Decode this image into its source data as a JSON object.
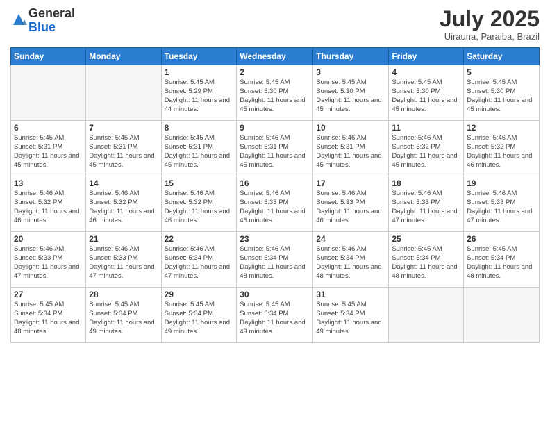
{
  "logo": {
    "general": "General",
    "blue": "Blue"
  },
  "title": "July 2025",
  "location": "Uirauna, Paraiba, Brazil",
  "headers": [
    "Sunday",
    "Monday",
    "Tuesday",
    "Wednesday",
    "Thursday",
    "Friday",
    "Saturday"
  ],
  "weeks": [
    [
      {
        "day": "",
        "info": ""
      },
      {
        "day": "",
        "info": ""
      },
      {
        "day": "1",
        "info": "Sunrise: 5:45 AM\nSunset: 5:29 PM\nDaylight: 11 hours and 44 minutes."
      },
      {
        "day": "2",
        "info": "Sunrise: 5:45 AM\nSunset: 5:30 PM\nDaylight: 11 hours and 45 minutes."
      },
      {
        "day": "3",
        "info": "Sunrise: 5:45 AM\nSunset: 5:30 PM\nDaylight: 11 hours and 45 minutes."
      },
      {
        "day": "4",
        "info": "Sunrise: 5:45 AM\nSunset: 5:30 PM\nDaylight: 11 hours and 45 minutes."
      },
      {
        "day": "5",
        "info": "Sunrise: 5:45 AM\nSunset: 5:30 PM\nDaylight: 11 hours and 45 minutes."
      }
    ],
    [
      {
        "day": "6",
        "info": "Sunrise: 5:45 AM\nSunset: 5:31 PM\nDaylight: 11 hours and 45 minutes."
      },
      {
        "day": "7",
        "info": "Sunrise: 5:45 AM\nSunset: 5:31 PM\nDaylight: 11 hours and 45 minutes."
      },
      {
        "day": "8",
        "info": "Sunrise: 5:45 AM\nSunset: 5:31 PM\nDaylight: 11 hours and 45 minutes."
      },
      {
        "day": "9",
        "info": "Sunrise: 5:46 AM\nSunset: 5:31 PM\nDaylight: 11 hours and 45 minutes."
      },
      {
        "day": "10",
        "info": "Sunrise: 5:46 AM\nSunset: 5:31 PM\nDaylight: 11 hours and 45 minutes."
      },
      {
        "day": "11",
        "info": "Sunrise: 5:46 AM\nSunset: 5:32 PM\nDaylight: 11 hours and 45 minutes."
      },
      {
        "day": "12",
        "info": "Sunrise: 5:46 AM\nSunset: 5:32 PM\nDaylight: 11 hours and 46 minutes."
      }
    ],
    [
      {
        "day": "13",
        "info": "Sunrise: 5:46 AM\nSunset: 5:32 PM\nDaylight: 11 hours and 46 minutes."
      },
      {
        "day": "14",
        "info": "Sunrise: 5:46 AM\nSunset: 5:32 PM\nDaylight: 11 hours and 46 minutes."
      },
      {
        "day": "15",
        "info": "Sunrise: 5:46 AM\nSunset: 5:32 PM\nDaylight: 11 hours and 46 minutes."
      },
      {
        "day": "16",
        "info": "Sunrise: 5:46 AM\nSunset: 5:33 PM\nDaylight: 11 hours and 46 minutes."
      },
      {
        "day": "17",
        "info": "Sunrise: 5:46 AM\nSunset: 5:33 PM\nDaylight: 11 hours and 46 minutes."
      },
      {
        "day": "18",
        "info": "Sunrise: 5:46 AM\nSunset: 5:33 PM\nDaylight: 11 hours and 47 minutes."
      },
      {
        "day": "19",
        "info": "Sunrise: 5:46 AM\nSunset: 5:33 PM\nDaylight: 11 hours and 47 minutes."
      }
    ],
    [
      {
        "day": "20",
        "info": "Sunrise: 5:46 AM\nSunset: 5:33 PM\nDaylight: 11 hours and 47 minutes."
      },
      {
        "day": "21",
        "info": "Sunrise: 5:46 AM\nSunset: 5:33 PM\nDaylight: 11 hours and 47 minutes."
      },
      {
        "day": "22",
        "info": "Sunrise: 5:46 AM\nSunset: 5:34 PM\nDaylight: 11 hours and 47 minutes."
      },
      {
        "day": "23",
        "info": "Sunrise: 5:46 AM\nSunset: 5:34 PM\nDaylight: 11 hours and 48 minutes."
      },
      {
        "day": "24",
        "info": "Sunrise: 5:46 AM\nSunset: 5:34 PM\nDaylight: 11 hours and 48 minutes."
      },
      {
        "day": "25",
        "info": "Sunrise: 5:45 AM\nSunset: 5:34 PM\nDaylight: 11 hours and 48 minutes."
      },
      {
        "day": "26",
        "info": "Sunrise: 5:45 AM\nSunset: 5:34 PM\nDaylight: 11 hours and 48 minutes."
      }
    ],
    [
      {
        "day": "27",
        "info": "Sunrise: 5:45 AM\nSunset: 5:34 PM\nDaylight: 11 hours and 48 minutes."
      },
      {
        "day": "28",
        "info": "Sunrise: 5:45 AM\nSunset: 5:34 PM\nDaylight: 11 hours and 49 minutes."
      },
      {
        "day": "29",
        "info": "Sunrise: 5:45 AM\nSunset: 5:34 PM\nDaylight: 11 hours and 49 minutes."
      },
      {
        "day": "30",
        "info": "Sunrise: 5:45 AM\nSunset: 5:34 PM\nDaylight: 11 hours and 49 minutes."
      },
      {
        "day": "31",
        "info": "Sunrise: 5:45 AM\nSunset: 5:34 PM\nDaylight: 11 hours and 49 minutes."
      },
      {
        "day": "",
        "info": ""
      },
      {
        "day": "",
        "info": ""
      }
    ]
  ]
}
